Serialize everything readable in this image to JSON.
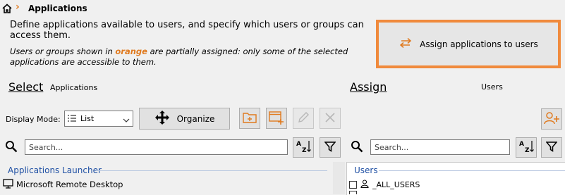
{
  "breadcrumb": {
    "separator": "›",
    "title": "Applications"
  },
  "description": "Define applications available to users, and specify which users or groups can access them.",
  "note": {
    "prefix": "Users or groups shown in ",
    "highlight": "orange",
    "suffix": " are partially assigned: only some of the selected applications are accessible to them."
  },
  "assign_button": {
    "label": "Assign applications to users"
  },
  "select_panel": {
    "title": "Select",
    "subtitle": "Applications",
    "display_mode_label": "Display Mode:",
    "display_mode_value": "List",
    "organize_label": "Organize",
    "search_placeholder": "Search...",
    "group_header": "Applications Launcher",
    "items": [
      {
        "label": "Microsoft Remote Desktop"
      }
    ]
  },
  "assign_panel": {
    "title": "Assign",
    "subtitle": "Users",
    "search_placeholder": "Search...",
    "group_header": "Users",
    "items": [
      {
        "label": "_ALL_USERS"
      }
    ]
  },
  "colors": {
    "accent": "#e07a1f",
    "assign_border": "#f08a3c",
    "group_header": "#1e4fa3"
  },
  "icons": [
    "home-icon",
    "assign-arrows-icon",
    "list-icon",
    "chevron-down-icon",
    "organize-move-icon",
    "new-folder-icon",
    "new-app-icon",
    "edit-pencil-icon",
    "delete-x-icon",
    "search-icon",
    "sort-az-icon",
    "filter-icon",
    "add-user-icon",
    "monitor-icon",
    "user-icon"
  ]
}
